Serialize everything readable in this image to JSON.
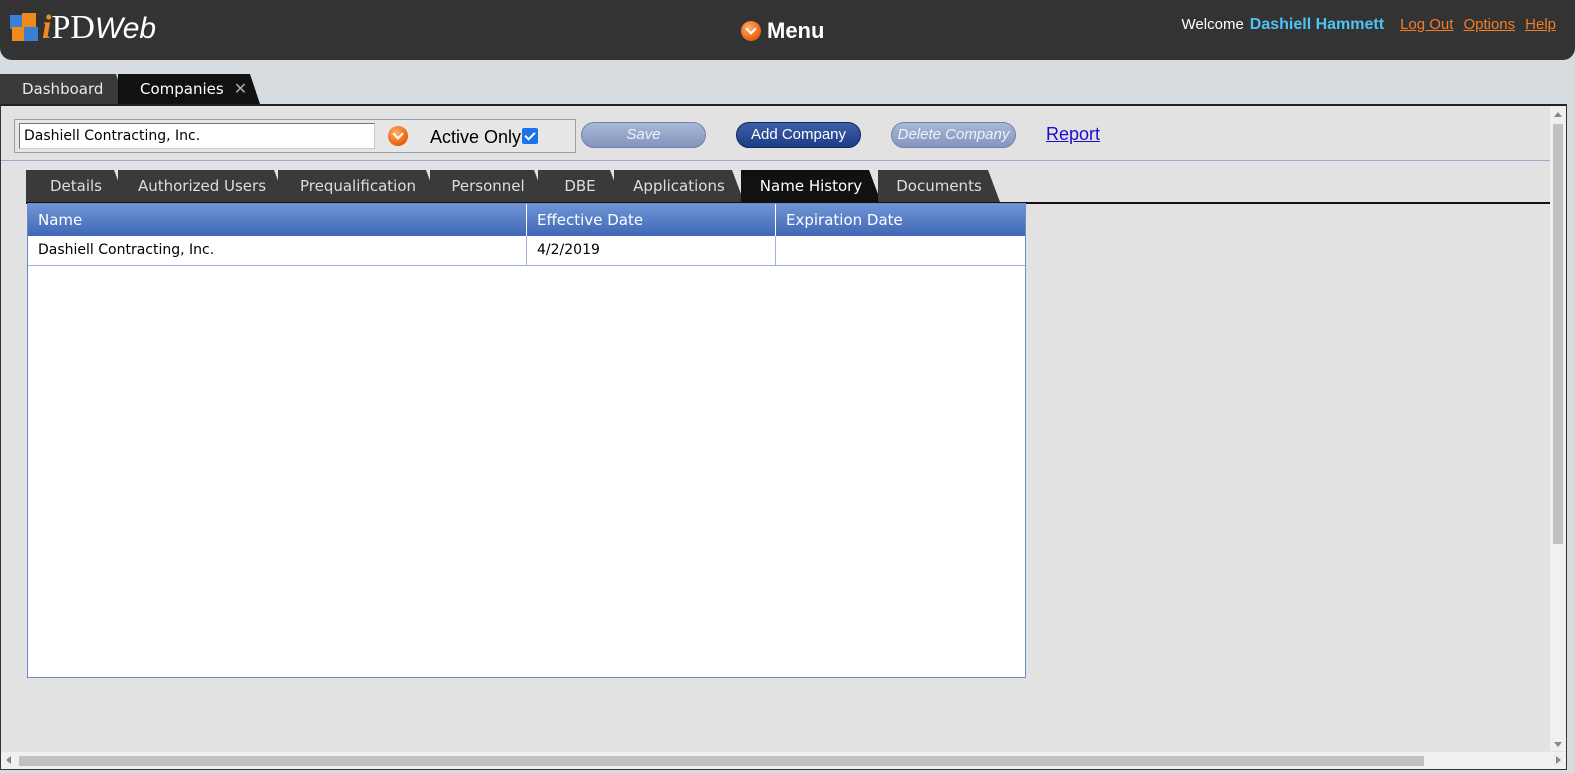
{
  "header": {
    "logo_i": "i",
    "logo_pd": "PD",
    "logo_web": "Web",
    "menu_label": "Menu",
    "welcome": "Welcome",
    "user_name": "Dashiell Hammett",
    "links": [
      "Log Out",
      "Options",
      "Help"
    ]
  },
  "main_tabs": {
    "dashboard": "Dashboard",
    "companies": "Companies",
    "close_glyph": "✕"
  },
  "toolbar": {
    "company_value": "Dashiell Contracting, Inc.",
    "active_only_label": "Active Only",
    "active_only_checked": true,
    "save_label": "Save",
    "add_label": "Add Company",
    "delete_label": "Delete Company",
    "report_label": "Report"
  },
  "sub_tabs": [
    "Details",
    "Authorized Users",
    "Prequalification",
    "Personnel",
    "DBE",
    "Applications",
    "Name History",
    "Documents"
  ],
  "active_sub_tab": "Name History",
  "grid": {
    "columns": [
      "Name",
      "Effective Date",
      "Expiration Date"
    ],
    "rows": [
      [
        "Dashiell Contracting, Inc.",
        "4/2/2019",
        ""
      ]
    ]
  },
  "colors": {
    "header_bg": "#333333",
    "accent_orange": "#f07e2a",
    "user_blue": "#4fc3f7",
    "grid_header": "#4f76c2",
    "button_dark": "#1d3d87"
  }
}
